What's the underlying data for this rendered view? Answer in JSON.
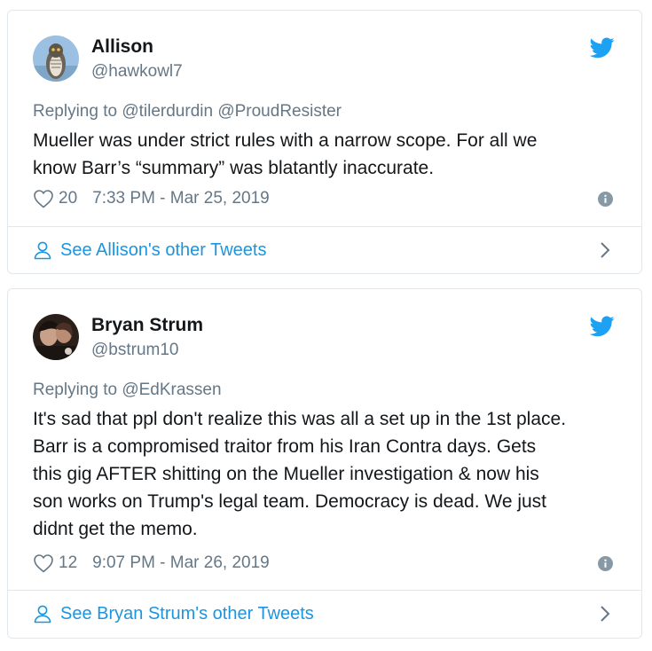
{
  "tweets": [
    {
      "name": "Allison",
      "handle": "@hawkowl7",
      "reply_to": "Replying to @tilerdurdin @ProudResister",
      "text": "Mueller was under strict rules with a narrow scope.  For all we\nknow Barr’s “summary” was blatantly inaccurate.",
      "likes": "20",
      "timestamp": "7:33 PM - Mar 25, 2019",
      "footer": "See Allison's other Tweets",
      "avatar_icon": "owl-avatar",
      "avatar_color": "#8fb3d6"
    },
    {
      "name": "Bryan Strum",
      "handle": "@bstrum10",
      "reply_to": "Replying to @EdKrassen",
      "text": "It's sad that ppl don't realize this was all a set up in the 1st place.\nBarr is a compromised traitor from his Iran Contra days. Gets\nthis gig AFTER shitting on the Mueller investigation & now his\nson works on Trump's legal team. Democracy is dead. We just\ndidnt get the memo.",
      "likes": "12",
      "timestamp": "9:07 PM - Mar 26, 2019",
      "footer": "See Bryan Strum's other Tweets",
      "avatar_icon": "person-photo-avatar",
      "avatar_color": "#3a2a22"
    }
  ],
  "colors": {
    "twitter_blue": "#1da1f2",
    "link_blue": "#1b95e0",
    "secondary_text": "#657786",
    "border": "#e1e8ed"
  }
}
